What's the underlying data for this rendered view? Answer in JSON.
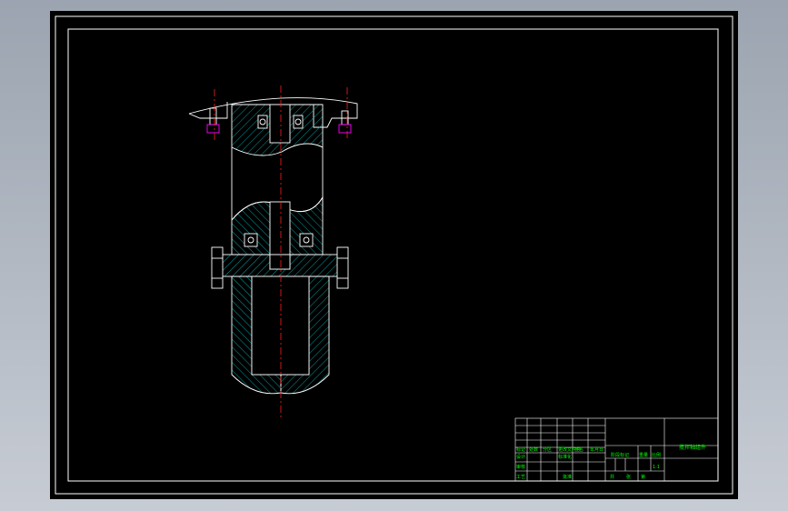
{
  "drawing": {
    "title": "搅拌轴组件",
    "scale": "1:1",
    "sheet": "共 张 第 张"
  },
  "title_block": {
    "row_labels": [
      "标记",
      "处数",
      "分区",
      "更改文件号",
      "签名",
      "年月日"
    ],
    "design": "设计",
    "standardization": "标准化",
    "stage_mark": "阶段标记",
    "weight": "重量",
    "ratio": "比例",
    "review": "审核",
    "process": "工艺",
    "approve": "批准",
    "count_total": "共",
    "count_sheet": "张",
    "count_no": "第"
  },
  "colors": {
    "frame": "#ffffff",
    "hatch": "#00c8c8",
    "centerline": "#ff2020",
    "bearing": "#ff00ff",
    "text": "#00ff00"
  }
}
